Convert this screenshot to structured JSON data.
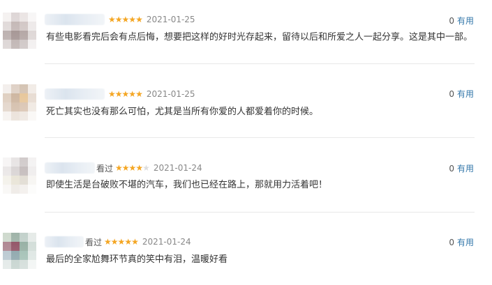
{
  "reviews": [
    {
      "status": "",
      "stars": 5,
      "date": "2021-01-25",
      "useful_count": "0",
      "useful_label": "有用",
      "content": "有些电影看完后会有点后悔，想要把这样的好时光存起来，留待以后和所爱之人一起分享。这是其中一部。"
    },
    {
      "status": "",
      "stars": 5,
      "date": "2021-01-25",
      "useful_count": "0",
      "useful_label": "有用",
      "content": "死亡其实也没有那么可怕，尤其是当所有你爱的人都爱着你的时候。"
    },
    {
      "status": "看过",
      "stars": 4,
      "date": "2021-01-24",
      "useful_count": "0",
      "useful_label": "有用",
      "content": "即使生活是台破败不堪的汽车，我们也已经在路上，那就用力活着吧！"
    },
    {
      "status": "看过",
      "stars": 5,
      "date": "2021-01-24",
      "useful_count": "0",
      "useful_label": "有用",
      "content": "最后的全家尬舞环节真的笑中有泪，温暖好看"
    }
  ],
  "colors": {
    "star_on": "#f4a623",
    "star_off": "#dddddd",
    "link": "#3377aa"
  },
  "icons": {
    "star": "★"
  }
}
